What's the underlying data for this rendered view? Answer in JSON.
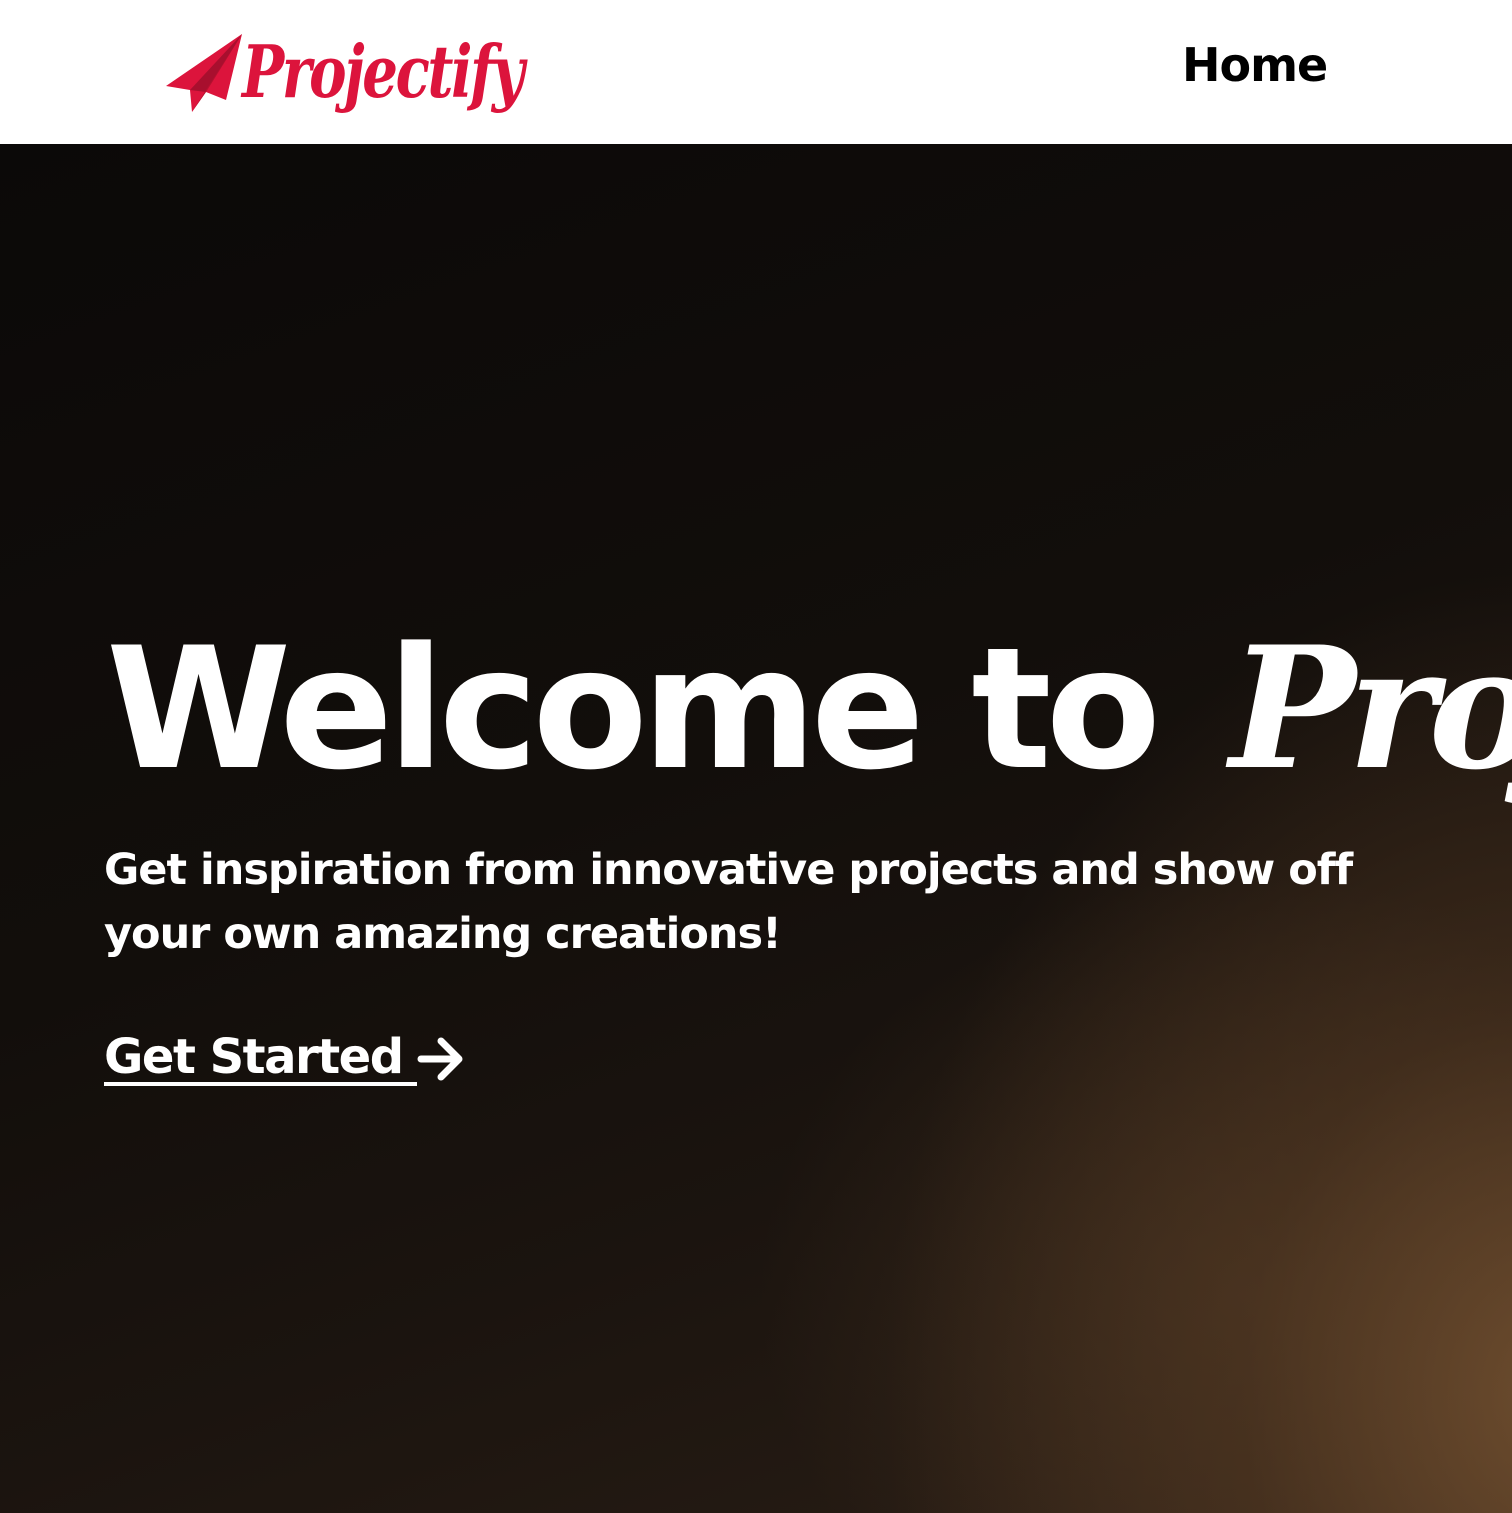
{
  "navbar": {
    "brand": "Projectify",
    "home_link": "Home"
  },
  "hero": {
    "title_prefix": "Welcome to ",
    "title_brand": "Projectify",
    "subtitle": "Get inspiration from innovative projects and show off your own amazing creations!",
    "cta_label": "Get Started"
  },
  "colors": {
    "brand": "#dc143c",
    "nav_background": "#ffffff",
    "hero_background": "#120e0b",
    "hero_text": "#ffffff"
  },
  "icons": {
    "logo": "paper-plane-icon",
    "cta": "arrow-right-icon"
  }
}
